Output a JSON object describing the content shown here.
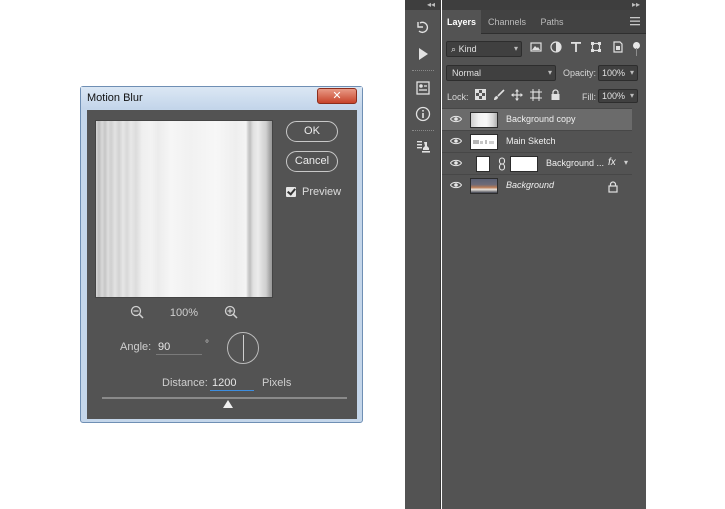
{
  "dialog": {
    "title": "Motion Blur",
    "close_label": "✕",
    "ok_label": "OK",
    "cancel_label": "Cancel",
    "preview_label": "Preview",
    "preview_checked": true,
    "zoom_level": "100%",
    "angle_label": "Angle:",
    "angle_value": "90",
    "degree_symbol": "°",
    "distance_label": "Distance:",
    "distance_value": "1200",
    "distance_unit": "Pixels"
  },
  "tools_panel": {
    "collapse_glyph": "◂◂",
    "icons": [
      "history-icon",
      "play-icon",
      "properties-icon",
      "info-icon",
      "clone-source-icon"
    ]
  },
  "layers_panel": {
    "collapse_glyph": "▸▸",
    "tabs": [
      {
        "label": "Layers",
        "active": true
      },
      {
        "label": "Channels",
        "active": false
      },
      {
        "label": "Paths",
        "active": false
      }
    ],
    "kind_label": "Kind",
    "kind_glyph": "⌕",
    "blend_mode": "Normal",
    "opacity_label": "Opacity:",
    "opacity_value": "100%",
    "lock_label": "Lock:",
    "fill_label": "Fill:",
    "fill_value": "100%",
    "layers": [
      {
        "name": "Background copy",
        "selected": true,
        "italic": false
      },
      {
        "name": "Main Sketch",
        "selected": false,
        "italic": false
      },
      {
        "name": "Background ...",
        "selected": false,
        "italic": false,
        "fx": "fx"
      },
      {
        "name": "Background",
        "selected": false,
        "italic": true,
        "locked": true
      }
    ]
  }
}
